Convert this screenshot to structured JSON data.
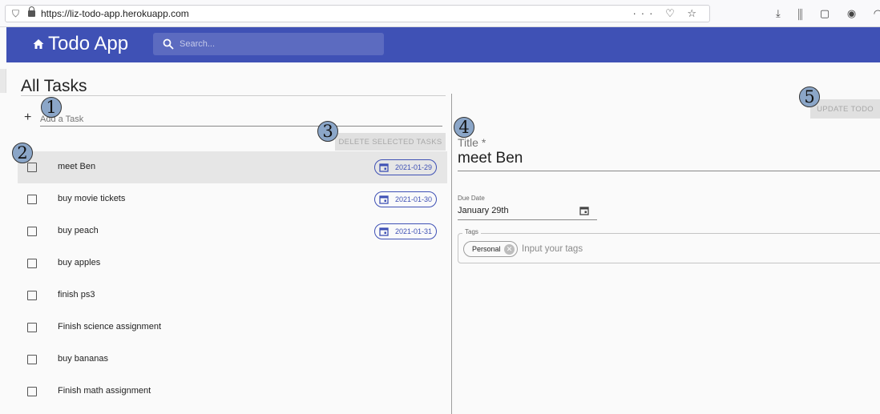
{
  "browser": {
    "url": "https://liz-todo-app.herokuapp.com",
    "url_actions": "··· ♡ ☆",
    "toolbar_icons": "⤓ ⫼ ▢ ◉ ◠⌄"
  },
  "appbar": {
    "title": "Todo App",
    "search_placeholder": "Search...",
    "color": "#3f51b5"
  },
  "left": {
    "page_title": "All Tasks",
    "add_placeholder": "Add a Task",
    "add_icon": "+",
    "delete_label": "DELETE SELECTED TASKS",
    "tasks": [
      {
        "label": "meet Ben",
        "date": "2021-01-29",
        "selected": true
      },
      {
        "label": "buy movie tickets",
        "date": "2021-01-30"
      },
      {
        "label": "buy peach",
        "date": "2021-01-31"
      },
      {
        "label": "buy apples"
      },
      {
        "label": "finish ps3"
      },
      {
        "label": "Finish science assignment"
      },
      {
        "label": "buy bananas"
      },
      {
        "label": "Finish math assignment"
      }
    ]
  },
  "right": {
    "update_label": "UPDATE TODO",
    "title_label": "Title *",
    "title_value": "meet Ben",
    "due_label": "Due Date",
    "due_value": "January 29th",
    "tags_label": "Tags",
    "tag": "Personal",
    "tags_placeholder": "Input your tags"
  },
  "markers": [
    "1",
    "2",
    "3",
    "4",
    "5"
  ]
}
